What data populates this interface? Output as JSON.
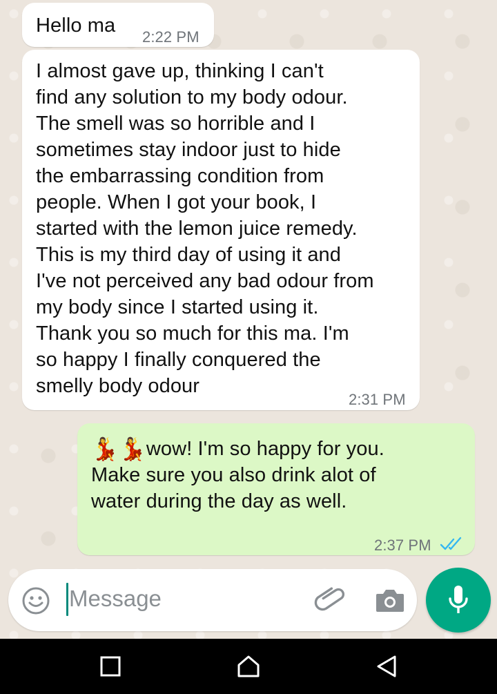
{
  "messages": [
    {
      "direction": "incoming",
      "text": "Hello ma",
      "time": "2:22 PM"
    },
    {
      "direction": "incoming",
      "text": "I almost gave up, thinking I can't\nfind any solution to my body odour.\nThe smell was so horrible and I\nsometimes stay indoor just to hide\nthe embarrassing condition from\npeople. When I got your book,  I\nstarted with the lemon juice remedy.\nThis is my third day of using it and\nI've not perceived any bad odour from\nmy body since I started using it.\nThank you so much for this ma. I'm\nso happy I finally conquered the\nsmelly body odour",
      "time": "2:31 PM"
    },
    {
      "direction": "outgoing",
      "emoji": "💃💃",
      "text": "wow! I'm so happy for you.\nMake sure you also drink alot of\nwater during the day as well.",
      "time": "2:37 PM",
      "status": "read",
      "status_icon": "double-check-icon",
      "status_color": "#34b7f1"
    }
  ],
  "composer": {
    "placeholder": "Message",
    "emoji_icon": "smiley-icon",
    "attach_icon": "paperclip-icon",
    "camera_icon": "camera-icon",
    "mic_icon": "microphone-icon",
    "accent_color": "#00a884"
  },
  "navbar": {
    "recents_icon": "square-icon",
    "home_icon": "home-icon",
    "back_icon": "back-triangle-icon"
  }
}
